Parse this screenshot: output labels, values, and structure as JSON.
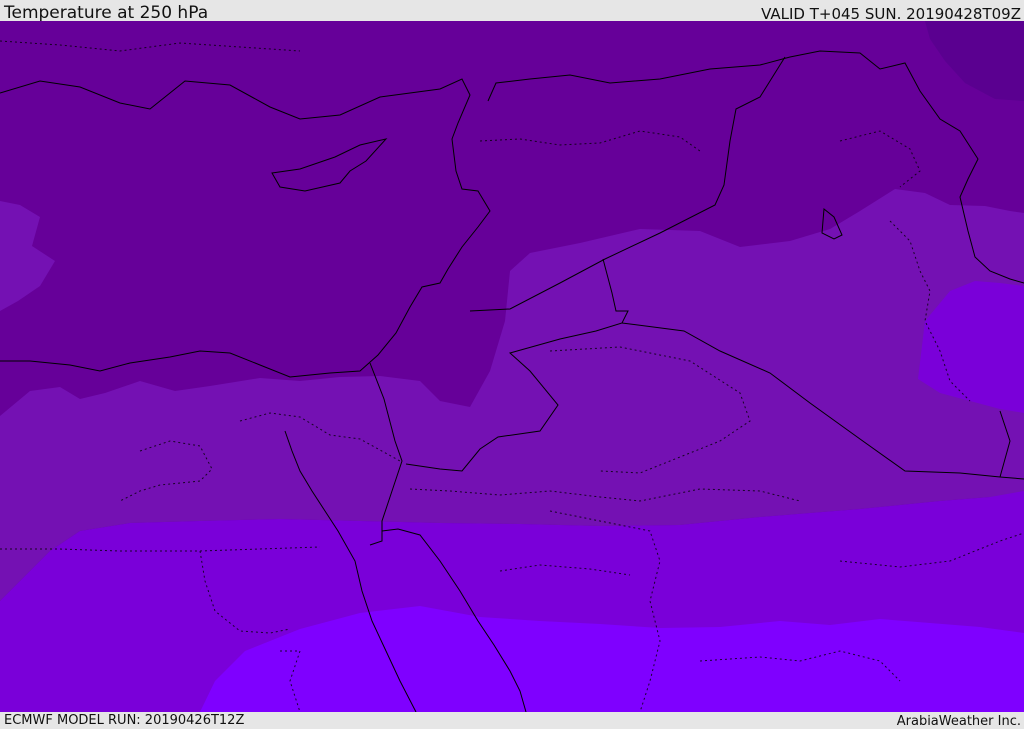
{
  "header": {
    "title": "Temperature at 250 hPa",
    "valid_time": "VALID T+045 SUN. 20190428T09Z"
  },
  "footer": {
    "model_run": "ECMWF MODEL RUN: 20190426T12Z",
    "credit": "ArabiaWeather Inc."
  },
  "map": {
    "temperature_band_colors": [
      "#5a0090",
      "#660099",
      "#7411b3",
      "#7a00d9",
      "#7f00ff"
    ],
    "border_color": "#000000"
  }
}
